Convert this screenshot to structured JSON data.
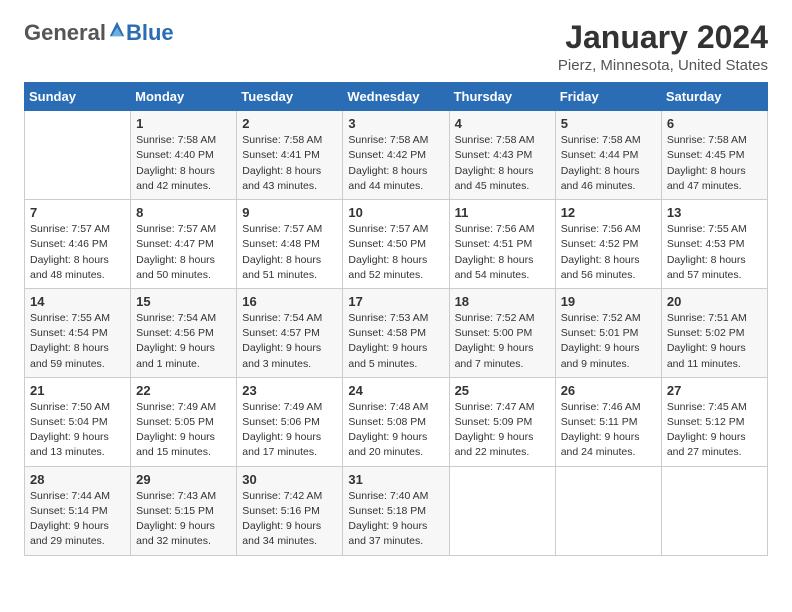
{
  "header": {
    "logo_general": "General",
    "logo_blue": "Blue",
    "month": "January 2024",
    "location": "Pierz, Minnesota, United States"
  },
  "days_of_week": [
    "Sunday",
    "Monday",
    "Tuesday",
    "Wednesday",
    "Thursday",
    "Friday",
    "Saturday"
  ],
  "weeks": [
    [
      {
        "day": "",
        "content": ""
      },
      {
        "day": "1",
        "content": "Sunrise: 7:58 AM\nSunset: 4:40 PM\nDaylight: 8 hours\nand 42 minutes."
      },
      {
        "day": "2",
        "content": "Sunrise: 7:58 AM\nSunset: 4:41 PM\nDaylight: 8 hours\nand 43 minutes."
      },
      {
        "day": "3",
        "content": "Sunrise: 7:58 AM\nSunset: 4:42 PM\nDaylight: 8 hours\nand 44 minutes."
      },
      {
        "day": "4",
        "content": "Sunrise: 7:58 AM\nSunset: 4:43 PM\nDaylight: 8 hours\nand 45 minutes."
      },
      {
        "day": "5",
        "content": "Sunrise: 7:58 AM\nSunset: 4:44 PM\nDaylight: 8 hours\nand 46 minutes."
      },
      {
        "day": "6",
        "content": "Sunrise: 7:58 AM\nSunset: 4:45 PM\nDaylight: 8 hours\nand 47 minutes."
      }
    ],
    [
      {
        "day": "7",
        "content": "Sunrise: 7:57 AM\nSunset: 4:46 PM\nDaylight: 8 hours\nand 48 minutes."
      },
      {
        "day": "8",
        "content": "Sunrise: 7:57 AM\nSunset: 4:47 PM\nDaylight: 8 hours\nand 50 minutes."
      },
      {
        "day": "9",
        "content": "Sunrise: 7:57 AM\nSunset: 4:48 PM\nDaylight: 8 hours\nand 51 minutes."
      },
      {
        "day": "10",
        "content": "Sunrise: 7:57 AM\nSunset: 4:50 PM\nDaylight: 8 hours\nand 52 minutes."
      },
      {
        "day": "11",
        "content": "Sunrise: 7:56 AM\nSunset: 4:51 PM\nDaylight: 8 hours\nand 54 minutes."
      },
      {
        "day": "12",
        "content": "Sunrise: 7:56 AM\nSunset: 4:52 PM\nDaylight: 8 hours\nand 56 minutes."
      },
      {
        "day": "13",
        "content": "Sunrise: 7:55 AM\nSunset: 4:53 PM\nDaylight: 8 hours\nand 57 minutes."
      }
    ],
    [
      {
        "day": "14",
        "content": "Sunrise: 7:55 AM\nSunset: 4:54 PM\nDaylight: 8 hours\nand 59 minutes."
      },
      {
        "day": "15",
        "content": "Sunrise: 7:54 AM\nSunset: 4:56 PM\nDaylight: 9 hours\nand 1 minute."
      },
      {
        "day": "16",
        "content": "Sunrise: 7:54 AM\nSunset: 4:57 PM\nDaylight: 9 hours\nand 3 minutes."
      },
      {
        "day": "17",
        "content": "Sunrise: 7:53 AM\nSunset: 4:58 PM\nDaylight: 9 hours\nand 5 minutes."
      },
      {
        "day": "18",
        "content": "Sunrise: 7:52 AM\nSunset: 5:00 PM\nDaylight: 9 hours\nand 7 minutes."
      },
      {
        "day": "19",
        "content": "Sunrise: 7:52 AM\nSunset: 5:01 PM\nDaylight: 9 hours\nand 9 minutes."
      },
      {
        "day": "20",
        "content": "Sunrise: 7:51 AM\nSunset: 5:02 PM\nDaylight: 9 hours\nand 11 minutes."
      }
    ],
    [
      {
        "day": "21",
        "content": "Sunrise: 7:50 AM\nSunset: 5:04 PM\nDaylight: 9 hours\nand 13 minutes."
      },
      {
        "day": "22",
        "content": "Sunrise: 7:49 AM\nSunset: 5:05 PM\nDaylight: 9 hours\nand 15 minutes."
      },
      {
        "day": "23",
        "content": "Sunrise: 7:49 AM\nSunset: 5:06 PM\nDaylight: 9 hours\nand 17 minutes."
      },
      {
        "day": "24",
        "content": "Sunrise: 7:48 AM\nSunset: 5:08 PM\nDaylight: 9 hours\nand 20 minutes."
      },
      {
        "day": "25",
        "content": "Sunrise: 7:47 AM\nSunset: 5:09 PM\nDaylight: 9 hours\nand 22 minutes."
      },
      {
        "day": "26",
        "content": "Sunrise: 7:46 AM\nSunset: 5:11 PM\nDaylight: 9 hours\nand 24 minutes."
      },
      {
        "day": "27",
        "content": "Sunrise: 7:45 AM\nSunset: 5:12 PM\nDaylight: 9 hours\nand 27 minutes."
      }
    ],
    [
      {
        "day": "28",
        "content": "Sunrise: 7:44 AM\nSunset: 5:14 PM\nDaylight: 9 hours\nand 29 minutes."
      },
      {
        "day": "29",
        "content": "Sunrise: 7:43 AM\nSunset: 5:15 PM\nDaylight: 9 hours\nand 32 minutes."
      },
      {
        "day": "30",
        "content": "Sunrise: 7:42 AM\nSunset: 5:16 PM\nDaylight: 9 hours\nand 34 minutes."
      },
      {
        "day": "31",
        "content": "Sunrise: 7:40 AM\nSunset: 5:18 PM\nDaylight: 9 hours\nand 37 minutes."
      },
      {
        "day": "",
        "content": ""
      },
      {
        "day": "",
        "content": ""
      },
      {
        "day": "",
        "content": ""
      }
    ]
  ]
}
